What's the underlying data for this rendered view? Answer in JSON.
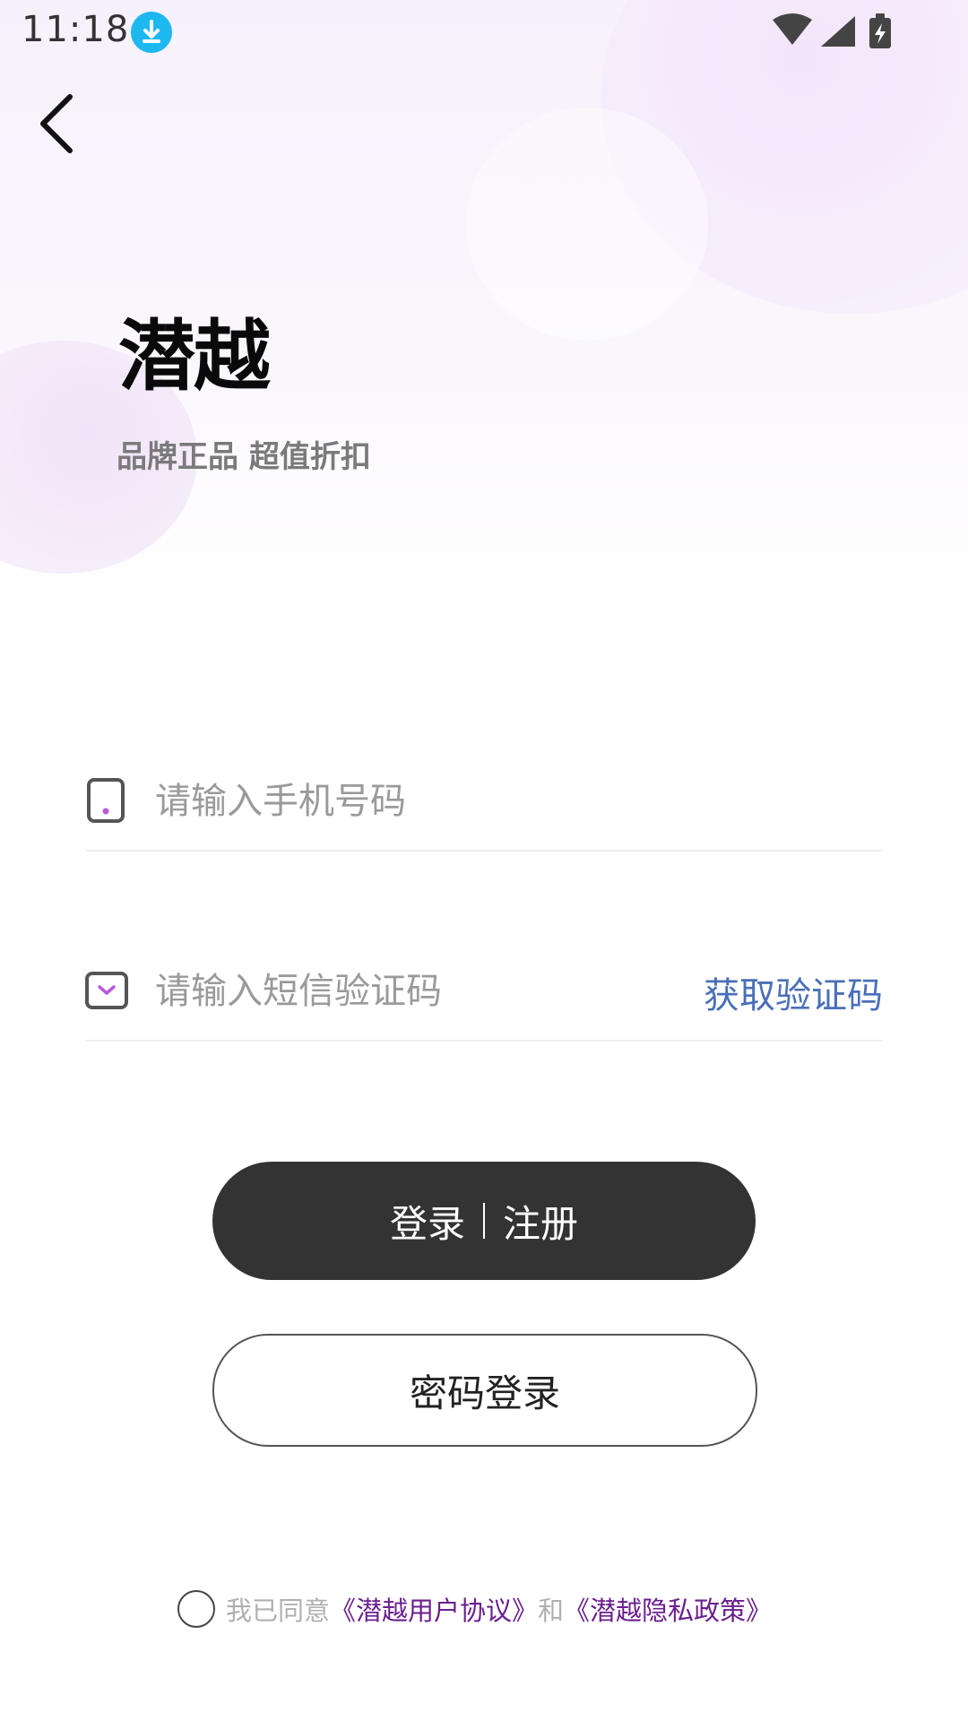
{
  "status_bar": {
    "time": "11:18",
    "icons": [
      "download-icon",
      "wifi-icon",
      "signal-icon",
      "battery-charging-icon"
    ]
  },
  "nav": {
    "back_icon": "chevron-left-icon"
  },
  "brand": {
    "logo_text": "潜越",
    "slogan": "品牌正品 超值折扣"
  },
  "form": {
    "phone": {
      "icon": "phone-icon",
      "placeholder": "请输入手机号码",
      "value": ""
    },
    "sms": {
      "icon": "message-icon",
      "placeholder": "请输入短信验证码",
      "value": "",
      "get_code_label": "获取验证码"
    }
  },
  "buttons": {
    "login_label": "登录",
    "register_label": "注册",
    "password_login_label": "密码登录"
  },
  "agreement": {
    "prefix": "我已同意",
    "user_agreement": "《潜越用户协议》",
    "conjunction": "和",
    "privacy_policy": "《潜越隐私政策》",
    "checked": false
  },
  "colors": {
    "accent_purple": "#6b1f8f",
    "link_blue": "#4a6fb8",
    "primary_button": "#333333",
    "download_badge": "#1eb8f0"
  }
}
